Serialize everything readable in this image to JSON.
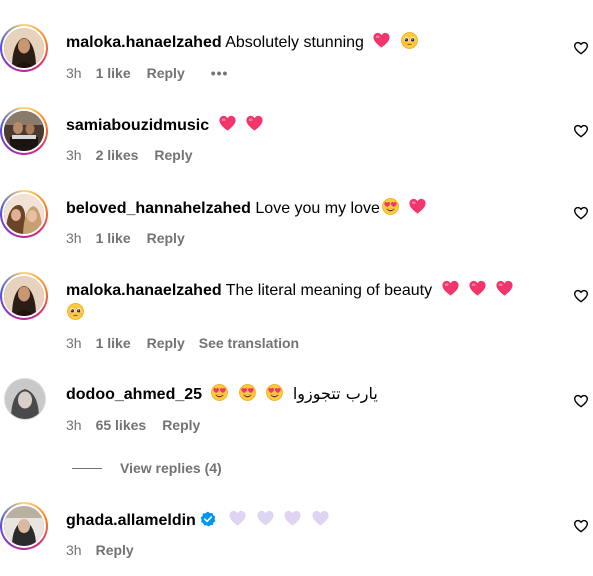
{
  "comments": [
    {
      "username": "maloka.hanaelzahed",
      "text": "Absolutely stunning",
      "time": "3h",
      "likes": "1 like",
      "reply": "Reply",
      "more": "•••"
    },
    {
      "username": "samiabouzidmusic",
      "text": "",
      "time": "3h",
      "likes": "2 likes",
      "reply": "Reply"
    },
    {
      "username": "beloved_hannahelzahed",
      "text": "Love you my love",
      "time": "3h",
      "likes": "1 like",
      "reply": "Reply"
    },
    {
      "username": "maloka.hanaelzahed",
      "text": "The literal meaning of beauty",
      "time": "3h",
      "likes": "1 like",
      "reply": "Reply",
      "translation": "See translation"
    },
    {
      "username": "dodoo_ahmed_25",
      "text": "يارب تتجوزوا",
      "time": "3h",
      "likes": "65 likes",
      "reply": "Reply"
    },
    {
      "username": "ghada.allameldin",
      "text": "",
      "time": "3h",
      "reply": "Reply"
    }
  ],
  "view_replies": "View replies (4)",
  "icons": {
    "heart": "heart-outline-icon",
    "pink_heart": "pink-heart-emoji",
    "pleading": "pleading-face-emoji",
    "heart_eyes": "heart-eyes-emoji",
    "white_heart": "light-purple-heart-emoji",
    "verified": "verified-badge-icon"
  },
  "colors": {
    "heart_emoji": "#f2356b",
    "light_heart": "#e0d4f3",
    "verified": "#0095f6",
    "meta": "#737373"
  }
}
